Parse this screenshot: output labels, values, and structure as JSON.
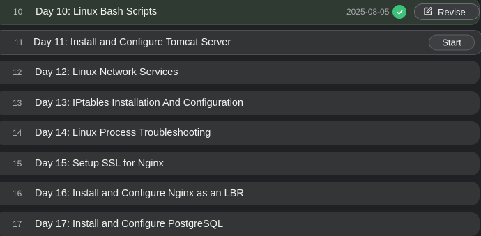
{
  "items": [
    {
      "num": "10",
      "title": "Day 10: Linux Bash Scripts",
      "date": "2025-08-05",
      "status": "completed",
      "action_label": "Revise",
      "action_icon": "edit-icon"
    },
    {
      "num": "11",
      "title": "Day 11: Install and Configure Tomcat Server",
      "status": "current",
      "action_label": "Start"
    },
    {
      "num": "12",
      "title": "Day 12: Linux Network Services"
    },
    {
      "num": "13",
      "title": "Day 13: IPtables Installation And Configuration"
    },
    {
      "num": "14",
      "title": "Day 14: Linux Process Troubleshooting"
    },
    {
      "num": "15",
      "title": "Day 15: Setup SSL for Nginx"
    },
    {
      "num": "16",
      "title": "Day 16: Install and Configure Nginx as an LBR"
    },
    {
      "num": "17",
      "title": "Day 17: Install and Configure PostgreSQL"
    }
  ],
  "colors": {
    "page_bg": "#202124",
    "row_bg": "#343537",
    "check_green": "#3ec27a"
  }
}
